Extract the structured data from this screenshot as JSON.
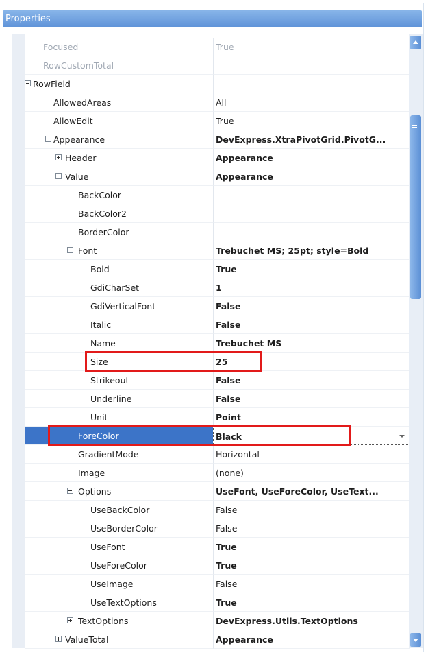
{
  "window": {
    "title": "Properties"
  },
  "highlight_color": "#e21a1a",
  "selected_row_color": "#3c74c8",
  "rows": [
    {
      "label": "Focused",
      "value": "True",
      "gray": true,
      "indent": 0
    },
    {
      "label": "RowCustomTotal",
      "value": "",
      "gray": true,
      "indent": 0
    },
    {
      "label": "RowField",
      "value": "",
      "toggle": "minus",
      "indent": -1
    },
    {
      "label": "AllowedAreas",
      "value": "All",
      "indent": 1
    },
    {
      "label": "AllowEdit",
      "value": "True",
      "indent": 1
    },
    {
      "label": "Appearance",
      "value": "DevExpress.XtraPivotGrid.PivotG...",
      "bold": true,
      "toggle": "minus",
      "indent": 1
    },
    {
      "label": "Header",
      "value": "Appearance",
      "bold": true,
      "toggle": "plus",
      "indent": 2
    },
    {
      "label": "Value",
      "value": "Appearance",
      "bold": true,
      "toggle": "minus",
      "indent": 2
    },
    {
      "label": "BackColor",
      "value": "",
      "indent": 3
    },
    {
      "label": "BackColor2",
      "value": "",
      "indent": 3
    },
    {
      "label": "BorderColor",
      "value": "",
      "indent": 3
    },
    {
      "label": "Font",
      "value": "Trebuchet MS; 25pt; style=Bold",
      "bold": true,
      "toggle": "minus",
      "indent": 3
    },
    {
      "label": "Bold",
      "value": "True",
      "bold": true,
      "indent": 4
    },
    {
      "label": "GdiCharSet",
      "value": "1",
      "bold": true,
      "indent": 4
    },
    {
      "label": "GdiVerticalFont",
      "value": "False",
      "bold": true,
      "indent": 4
    },
    {
      "label": "Italic",
      "value": "False",
      "bold": true,
      "indent": 4
    },
    {
      "label": "Name",
      "value": "Trebuchet MS",
      "bold": true,
      "indent": 4
    },
    {
      "label": "Size",
      "value": "25",
      "bold": true,
      "indent": 4
    },
    {
      "label": "Strikeout",
      "value": "False",
      "bold": true,
      "indent": 4
    },
    {
      "label": "Underline",
      "value": "False",
      "bold": true,
      "indent": 4
    },
    {
      "label": "Unit",
      "value": "Point",
      "bold": true,
      "indent": 4
    },
    {
      "label": "ForeColor",
      "value": "Black",
      "bold": true,
      "indent": 3,
      "selected": true
    },
    {
      "label": "GradientMode",
      "value": "Horizontal",
      "indent": 3
    },
    {
      "label": "Image",
      "value": "(none)",
      "indent": 3
    },
    {
      "label": "Options",
      "value": "UseFont, UseForeColor, UseText...",
      "bold": true,
      "toggle": "minus",
      "indent": 3
    },
    {
      "label": "UseBackColor",
      "value": "False",
      "indent": 4
    },
    {
      "label": "UseBorderColor",
      "value": "False",
      "indent": 4
    },
    {
      "label": "UseFont",
      "value": "True",
      "bold": true,
      "indent": 4
    },
    {
      "label": "UseForeColor",
      "value": "True",
      "bold": true,
      "indent": 4
    },
    {
      "label": "UseImage",
      "value": "False",
      "indent": 4
    },
    {
      "label": "UseTextOptions",
      "value": "True",
      "bold": true,
      "indent": 4
    },
    {
      "label": "TextOptions",
      "value": "DevExpress.Utils.TextOptions",
      "bold": true,
      "toggle": "plus",
      "indent": 3
    },
    {
      "label": "ValueTotal",
      "value": "Appearance",
      "bold": true,
      "toggle": "plus",
      "indent": 2
    }
  ]
}
